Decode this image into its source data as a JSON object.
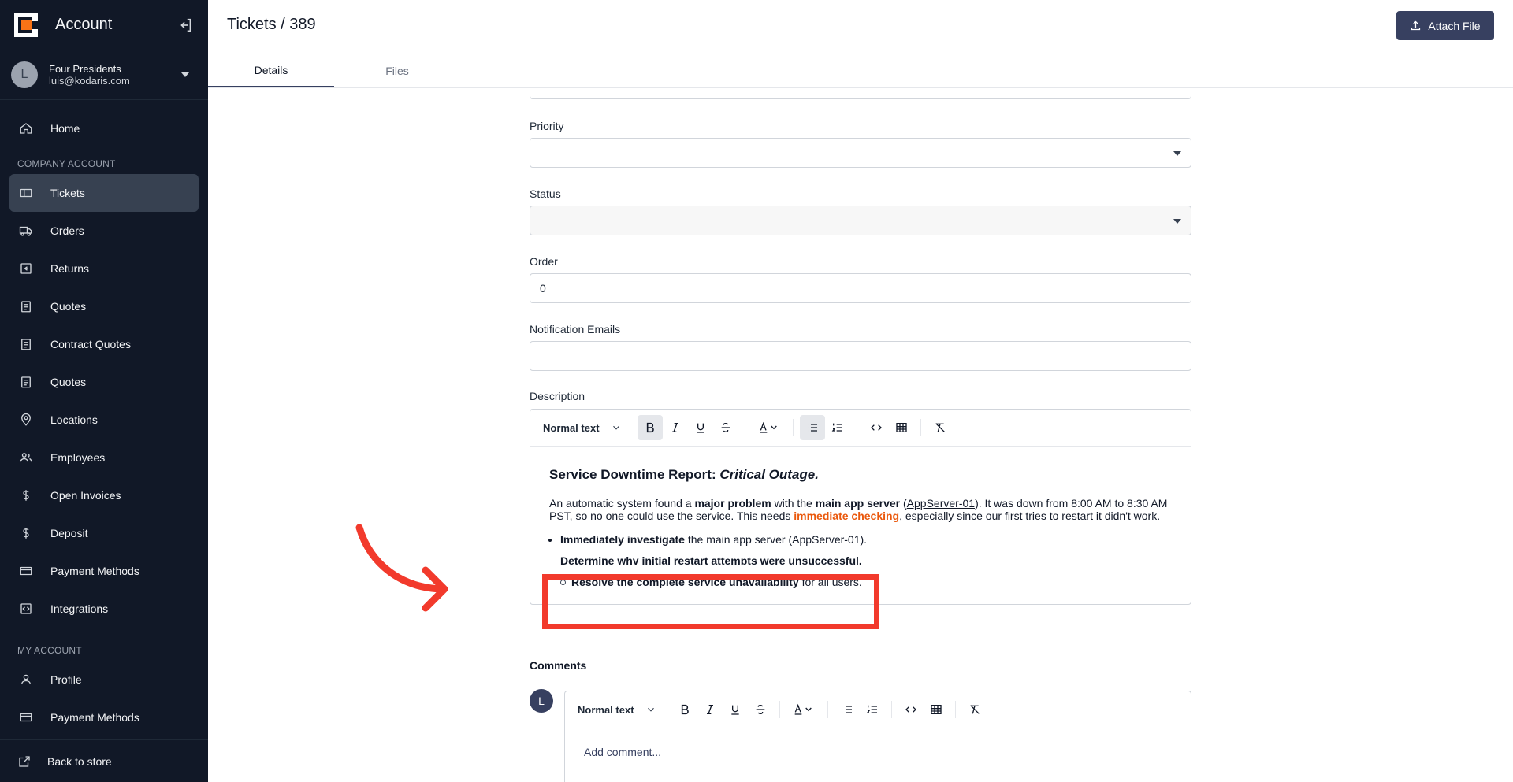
{
  "sidebar": {
    "title": "Account",
    "account": {
      "initial": "L",
      "name": "Four Presidents",
      "email": "luis@kodaris.com"
    },
    "home": "Home",
    "section_company": "COMPANY ACCOUNT",
    "items": [
      {
        "label": "Tickets",
        "icon": "ticket-icon"
      },
      {
        "label": "Orders",
        "icon": "truck-icon"
      },
      {
        "label": "Returns",
        "icon": "return-icon"
      },
      {
        "label": "Quotes",
        "icon": "clipboard-icon"
      },
      {
        "label": "Contract Quotes",
        "icon": "clipboard-icon"
      },
      {
        "label": "Quotes",
        "icon": "clipboard-icon"
      },
      {
        "label": "Locations",
        "icon": "map-pin-icon"
      },
      {
        "label": "Employees",
        "icon": "users-icon"
      },
      {
        "label": "Open Invoices",
        "icon": "dollar-icon"
      },
      {
        "label": "Deposit",
        "icon": "dollar-icon"
      },
      {
        "label": "Payment Methods",
        "icon": "credit-card-icon"
      },
      {
        "label": "Integrations",
        "icon": "integration-icon"
      }
    ],
    "section_my": "MY ACCOUNT",
    "my_items": [
      {
        "label": "Profile",
        "icon": "user-icon"
      },
      {
        "label": "Payment Methods",
        "icon": "credit-card-icon"
      }
    ],
    "back": "Back to store"
  },
  "header": {
    "breadcrumb": "Tickets / 389",
    "attach_label": "Attach File",
    "tabs": [
      "Details",
      "Files"
    ]
  },
  "form": {
    "priority_label": "Priority",
    "status_label": "Status",
    "order_label": "Order",
    "order_value": "0",
    "notification_label": "Notification Emails",
    "description_label": "Description",
    "toolbar_style": "Normal text"
  },
  "description": {
    "title_plain": "Service Downtime Report: ",
    "title_em": "Critical Outage.",
    "p_1": "An automatic system found a ",
    "p_bold1": "major problem",
    "p_2": " with the ",
    "p_bold2": "main app server",
    "p_3": " (",
    "p_link": "AppServer-01",
    "p_4": "). It was down from 8:00 AM to 8:30 AM PST, so no one could use the service. This needs ",
    "p_link2": "immediate checking",
    "p_5": ", especially since our first tries to restart it didn't work.",
    "li1_bold": "Immediately investigate",
    "li1_rest": " the main app server (AppServer-01).",
    "li2_hidden": "Determine why initial restart attempts were unsuccessful.",
    "li3_bold": "Resolve the complete service unavailability",
    "li3_rest": " for all users."
  },
  "comments": {
    "label": "Comments",
    "avatar": "L",
    "toolbar_style": "Normal text",
    "placeholder": "Add comment..."
  },
  "colors": {
    "sidebar_bg": "#111827",
    "accent": "#374060",
    "link": "#ea580c",
    "highlight": "#f23a2c"
  }
}
